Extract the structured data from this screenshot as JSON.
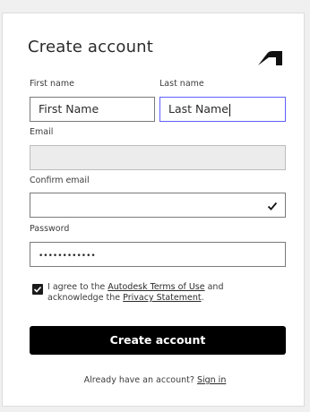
{
  "form": {
    "title": "Create account",
    "first_name_label": "First name",
    "first_name_value": "First Name",
    "last_name_label": "Last name",
    "last_name_value": "Last Name",
    "email_label": "Email",
    "email_value": "",
    "confirm_email_label": "Confirm email",
    "confirm_email_value": "",
    "password_label": "Password",
    "password_value": "••••••••••••",
    "agree_checked": true,
    "agree_prefix": "I agree to the ",
    "agree_link1": "Autodesk Terms of Use",
    "agree_middle": " and acknowledge the ",
    "agree_link2": "Privacy Statement",
    "agree_suffix": ".",
    "submit_label": "Create account",
    "signin_prefix": "Already have an account? ",
    "signin_link": "Sign in"
  },
  "icons": {
    "logo": "autodesk-logo-icon",
    "confirm_check": "checkmark-icon"
  },
  "colors": {
    "focus_border": "#5f60ff",
    "button_bg": "#000000",
    "disabled_bg": "#ececec"
  }
}
